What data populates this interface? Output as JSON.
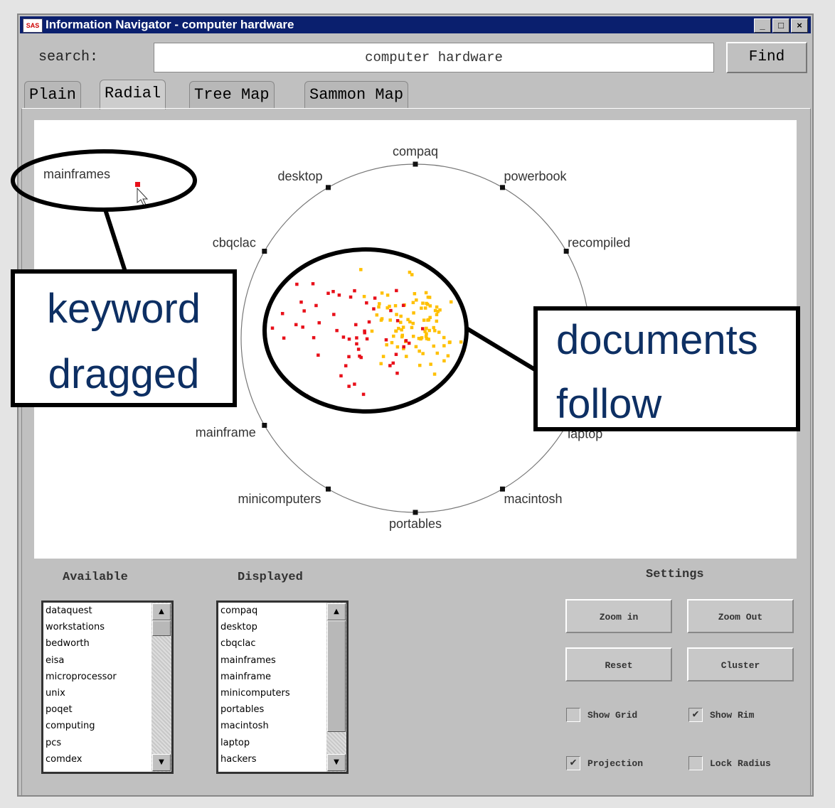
{
  "window": {
    "title": "Information Navigator - computer hardware",
    "icon": "app-icon",
    "controls": [
      "_",
      "□",
      "×"
    ]
  },
  "search": {
    "label": "search:",
    "value": "computer hardware",
    "find": "Find"
  },
  "tabs": [
    {
      "label": "Plain"
    },
    {
      "label": "Radial",
      "active": true
    },
    {
      "label": "Tree Map"
    },
    {
      "label": "Sammon Map"
    }
  ],
  "radial": {
    "keywords": [
      "compaq",
      "powerbook",
      "recompiled",
      "laptop",
      "macintosh",
      "portables",
      "minicomputers",
      "mainframe",
      "cbqclac",
      "desktop"
    ],
    "dragged_keyword": "mainframes",
    "colors": {
      "rim": "#777777",
      "doc_red": "#e8101a",
      "doc_yellow": "#ffc000",
      "node": "#111111",
      "dragged_node": "#e8101a"
    }
  },
  "callouts": {
    "left": "keyword dragged",
    "right": "documents follow",
    "text_color": "#0d2f63"
  },
  "available": {
    "header": "Available",
    "items": [
      "dataquest",
      "workstations",
      "bedworth",
      "eisa",
      "microprocessor",
      "unix",
      "poqet",
      "computing",
      "pcs",
      "comdex"
    ]
  },
  "displayed": {
    "header": "Displayed",
    "items": [
      "compaq",
      "desktop",
      "cbqclac",
      "mainframes",
      "mainframe",
      "minicomputers",
      "portables",
      "macintosh",
      "laptop",
      "hackers"
    ]
  },
  "settings": {
    "header": "Settings",
    "buttons": [
      "Zoom in",
      "Zoom Out",
      "Reset",
      "Cluster"
    ],
    "checkboxes": [
      {
        "label": "Show Grid",
        "checked": false
      },
      {
        "label": "Show Rim",
        "checked": true
      },
      {
        "label": "Projection",
        "checked": true
      },
      {
        "label": "Lock Radius",
        "checked": false
      }
    ]
  }
}
